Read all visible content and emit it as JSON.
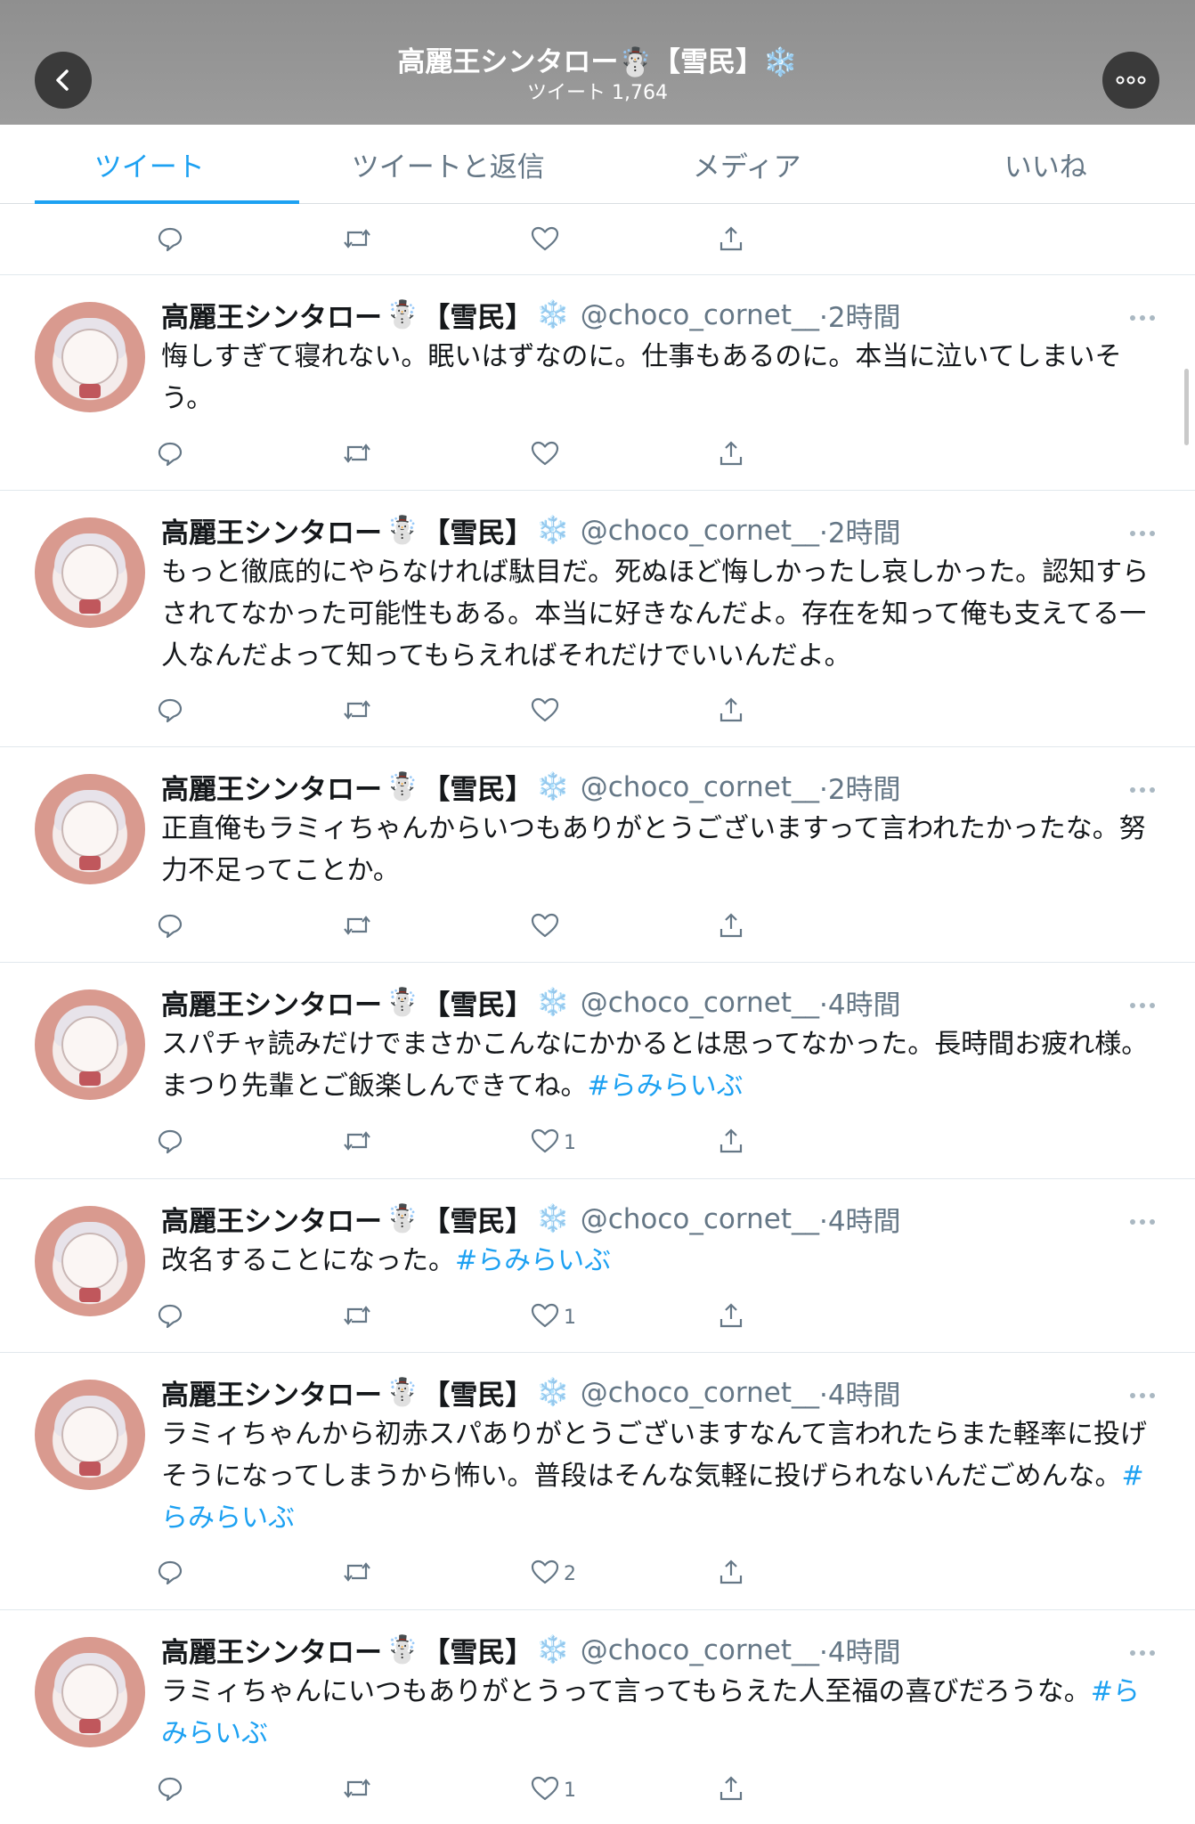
{
  "header": {
    "title": "高麗王シンタロー☃️【雪民】❄️",
    "subtitle": "ツイート 1,764",
    "back_icon": "chevron-left-icon",
    "more_icon": "more-icon"
  },
  "tabs": [
    {
      "label": "ツイート",
      "active": true
    },
    {
      "label": "ツイートと返信",
      "active": false
    },
    {
      "label": "メディア",
      "active": false
    },
    {
      "label": "いいね",
      "active": false
    }
  ],
  "colors": {
    "accent": "#1da1f2",
    "header_bg": "#969696",
    "secondary_text": "#657786"
  },
  "author": {
    "name": "高麗王シンタロー",
    "snowman": "☃️",
    "tag": "【雪民】",
    "snowflake": "❄️",
    "handle": "@choco_cornet__"
  },
  "tweets": [
    {
      "time": "·2時間",
      "text": "悔しすぎて寝れない。眠いはずなのに。仕事もあるのに。本当に泣いてしまいそう。",
      "hashtag": "",
      "likes": ""
    },
    {
      "time": "·2時間",
      "text": "もっと徹底的にやらなければ駄目だ。死ぬほど悔しかったし哀しかった。認知すらされてなかった可能性もある。本当に好きなんだよ。存在を知って俺も支えてる一人なんだよって知ってもらえればそれだけでいいんだよ。",
      "hashtag": "",
      "likes": ""
    },
    {
      "time": "·2時間",
      "text": "正直俺もラミィちゃんからいつもありがとうございますって言われたかったな。努力不足ってことか。",
      "hashtag": "",
      "likes": ""
    },
    {
      "time": "·4時間",
      "text": "スパチャ読みだけでまさかこんなにかかるとは思ってなかった。長時間お疲れ様。まつり先輩とご飯楽しんできてね。",
      "hashtag": "#らみらいぶ",
      "likes": "1"
    },
    {
      "time": "·4時間",
      "text": "改名することになった。",
      "hashtag": "#らみらいぶ",
      "likes": "1"
    },
    {
      "time": "·4時間",
      "text": "ラミィちゃんから初赤スパありがとうございますなんて言われたらまた軽率に投げそうになってしまうから怖い。普段はそんな気軽に投げられないんだごめんな。",
      "hashtag": "#らみらいぶ",
      "likes": "2"
    },
    {
      "time": "·4時間",
      "text": "ラミィちゃんにいつもありがとうって言ってもらえた人至福の喜びだろうな。",
      "hashtag": "#らみらいぶ",
      "likes": "1"
    }
  ]
}
